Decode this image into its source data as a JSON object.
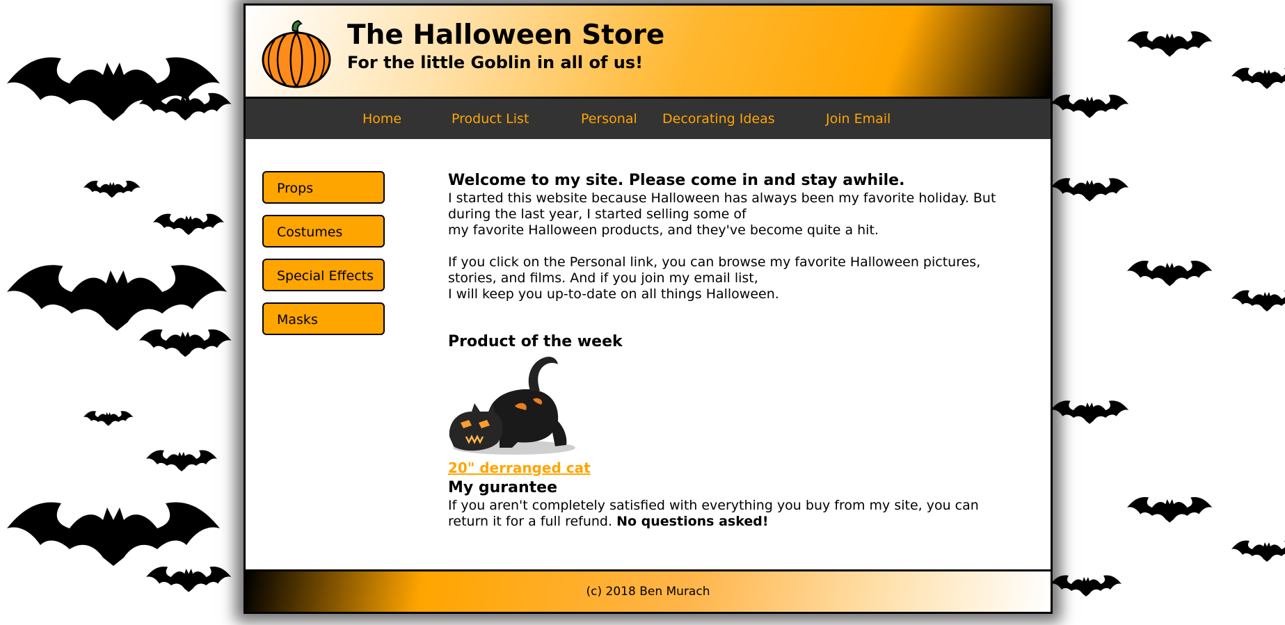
{
  "header": {
    "title": "The Halloween Store",
    "tagline": "For the little Goblin in all of us!",
    "logo_icon": "pumpkin-icon"
  },
  "nav": {
    "items": [
      {
        "label": "Home"
      },
      {
        "label": "Product List"
      },
      {
        "label": "Personal"
      },
      {
        "label": "Decorating Ideas"
      },
      {
        "label": "Join Email"
      }
    ]
  },
  "sidebar": {
    "items": [
      {
        "label": "Props"
      },
      {
        "label": "Costumes"
      },
      {
        "label": "Special Effects"
      },
      {
        "label": "Masks"
      }
    ]
  },
  "main": {
    "welcome_heading": "Welcome to my site. Please come in and stay awhile.",
    "intro_p1_line1": "I started this website because Halloween has always been my favorite holiday. But during the last year, I started selling some of",
    "intro_p1_line2": "my favorite Halloween products, and they've become quite a hit.",
    "intro_p2_line1": "If you click on the Personal link, you can browse my favorite Halloween pictures, stories, and films. And if you join my email list,",
    "intro_p2_line2": "I will keep you up-to-date on all things Halloween.",
    "product_heading": "Product of the week",
    "product_image": "black-cat-inflatable-image",
    "product_link": "20\" derranged cat",
    "guarantee_heading": "My gurantee",
    "guarantee_text": "If you aren't completely satisfied with everything you buy from my site, you can return it for a full refund.",
    "guarantee_emphasis": "No questions asked!"
  },
  "footer": {
    "copyright": "(c) 2018 Ben Murach"
  },
  "colors": {
    "accent": "#ffa500",
    "nav_bg": "#333333",
    "text": "#000000"
  },
  "background_pattern": "bat-silhouettes"
}
